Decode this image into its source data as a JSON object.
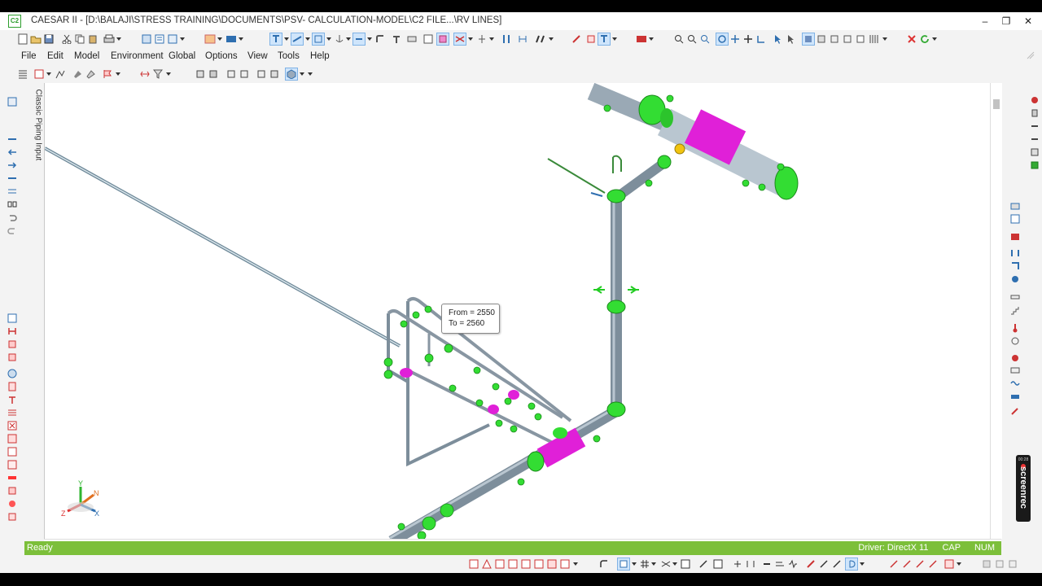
{
  "window": {
    "app_icon": "C2",
    "title": "CAESAR II - [D:\\BALAJI\\STRESS TRAINING\\DOCUMENTS\\PSV- CALCULATION-MODEL\\C2 FILE...\\RV LINES]",
    "minimize_glyph": "–",
    "restore_glyph": "❐",
    "close_glyph": "✕"
  },
  "menu": {
    "items": [
      "File",
      "Edit",
      "Model",
      "Environment",
      "Global",
      "Options",
      "View",
      "Tools",
      "Help"
    ]
  },
  "side_tab": {
    "label": "Classic Piping Input"
  },
  "tooltip": {
    "from_line": "From = 2550",
    "to_line": "To = 2560"
  },
  "status": {
    "left": "Ready",
    "driver": "Driver: DirectX 11",
    "cap": "CAP",
    "num": "NUM"
  },
  "axes": {
    "y_label": "Y",
    "n_label": "N",
    "x_label": "X",
    "z_label": "Z"
  },
  "screenrec": {
    "time": "00:28",
    "label": "screenrec"
  },
  "colors": {
    "pipe": "#8a9aa8",
    "fitting_green": "#33dd33",
    "equipment_magenta": "#e020d8",
    "status_green": "#7cbf3a",
    "accent_blue": "#2f6fb0"
  },
  "icons": {
    "toolbar1": [
      "new-icon",
      "open-icon",
      "save-icon",
      "cut-icon",
      "copy-icon",
      "paste-icon",
      "print-icon",
      "grid-icon",
      "list-icon",
      "table-icon",
      "compare-icon",
      "render-icon",
      "support-icon",
      "restraint-icon",
      "node-icon",
      "anchor-icon",
      "hanger-icon",
      "bend-icon",
      "tee-icon",
      "elevation-icon",
      "zoom-icon",
      "measure-icon",
      "valve-icon",
      "flange-icon",
      "bolt-icon",
      "weld-icon",
      "section-icon",
      "pipe-icon",
      "camera-icon",
      "orbit-icon",
      "pan-icon",
      "zoom-window-icon",
      "zoom-in-icon",
      "select-icon",
      "cursor-icon",
      "view-icon",
      "box-icon",
      "cube-icon",
      "wire-icon",
      "shade-icon",
      "split-icon",
      "close-red-icon",
      "refresh-icon"
    ],
    "toolbar2": [
      "undo-icon",
      "redo-icon",
      "graph-icon",
      "flag-icon",
      "paint-icon",
      "scale-icon",
      "filter-icon",
      "snap-icon",
      "pan-view-icon",
      "rotate-icon",
      "grid-view-icon",
      "cube-view-icon",
      "ortho-icon",
      "fit-icon"
    ]
  }
}
